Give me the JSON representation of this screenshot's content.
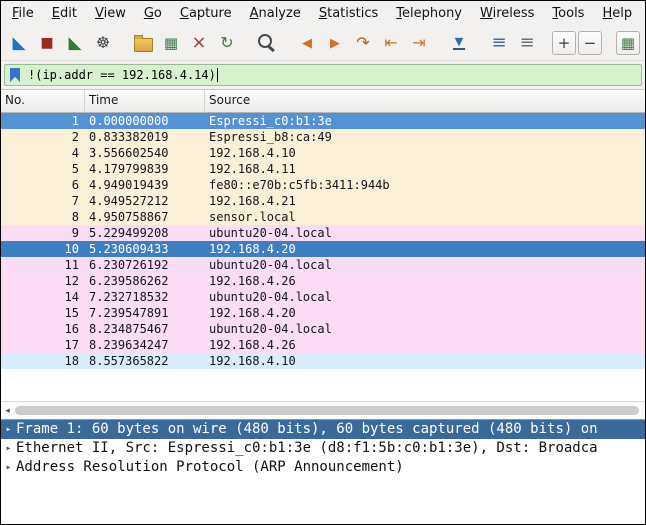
{
  "menu": {
    "items": [
      "File",
      "Edit",
      "View",
      "Go",
      "Capture",
      "Analyze",
      "Statistics",
      "Telephony",
      "Wireless",
      "Tools",
      "Help"
    ]
  },
  "toolbar": {
    "icons": [
      {
        "name": "start-capture",
        "glyph": "◣",
        "color": "#2571c4",
        "size": 17
      },
      {
        "name": "stop-capture",
        "glyph": "■",
        "color": "#9a2b20",
        "size": 14
      },
      {
        "name": "restart-capture",
        "glyph": "◣",
        "color": "#2e7d32",
        "size": 17
      },
      {
        "name": "capture-options",
        "glyph": "☸",
        "color": "#454545",
        "size": 16
      },
      {
        "gap": true
      },
      {
        "name": "open-capture-file",
        "shape": "folder"
      },
      {
        "name": "save-capture-file",
        "glyph": "▦",
        "color": "#3f7d46",
        "size": 15
      },
      {
        "name": "close-capture-file",
        "glyph": "×",
        "color": "#a83a2e",
        "size": 18
      },
      {
        "name": "reload-capture-file",
        "glyph": "↻",
        "color": "#3f7d46",
        "size": 16
      },
      {
        "gap": true
      },
      {
        "name": "find-packet",
        "shape": "magnifier"
      },
      {
        "gap": true
      },
      {
        "name": "go-back",
        "glyph": "◀",
        "color": "#d4712b",
        "size": 13
      },
      {
        "name": "go-forward",
        "glyph": "▶",
        "color": "#d4712b",
        "size": 13
      },
      {
        "name": "go-to-packet",
        "glyph": "↷",
        "color": "#c85a1b",
        "size": 16
      },
      {
        "name": "go-first-packet",
        "glyph": "⇤",
        "color": "#d4712b",
        "size": 16
      },
      {
        "name": "go-last-packet",
        "glyph": "⇥",
        "color": "#d4712b",
        "size": 16
      },
      {
        "gap": true
      },
      {
        "name": "auto-scroll",
        "glyph": "▼",
        "color": "#2a6db0",
        "size": 11,
        "cls": "g-underbar"
      },
      {
        "gap": true
      },
      {
        "name": "colorize-packets",
        "glyph": "≡",
        "color": "#3a6ea5",
        "size": 18
      },
      {
        "name": "coloring-rules",
        "glyph": "≡",
        "color": "#6d6d6d",
        "size": 18
      },
      {
        "spacer": true
      },
      {
        "name": "zoom-in",
        "glyph": "+",
        "color": "#3d3d3d",
        "size": 15,
        "boxed": true
      },
      {
        "name": "zoom-out",
        "glyph": "−",
        "color": "#3d3d3d",
        "size": 15,
        "boxed": true
      },
      {
        "gap": true
      },
      {
        "name": "resize-columns",
        "glyph": "▦",
        "color": "#3f7d46",
        "size": 15,
        "boxed": true
      }
    ]
  },
  "filter": {
    "value": "!(ip.addr == 192.168.4.14)"
  },
  "packet_list": {
    "columns": [
      "No.",
      "Time",
      "Source"
    ],
    "rows": [
      {
        "no": "1",
        "time": "0.000000000",
        "source": "Espressi_c0:b1:3e",
        "style": "selected"
      },
      {
        "no": "2",
        "time": "0.833382019",
        "source": "Espressi_b8:ca:49",
        "style": "cream"
      },
      {
        "no": "4",
        "time": "3.556602540",
        "source": "192.168.4.10",
        "style": "cream"
      },
      {
        "no": "5",
        "time": "4.179799839",
        "source": "192.168.4.11",
        "style": "cream"
      },
      {
        "no": "6",
        "time": "4.949019439",
        "source": "fe80::e70b:c5fb:3411:944b",
        "style": "cream"
      },
      {
        "no": "7",
        "time": "4.949527212",
        "source": "192.168.4.21",
        "style": "cream"
      },
      {
        "no": "8",
        "time": "4.950758867",
        "source": "sensor.local",
        "style": "cream"
      },
      {
        "no": "9",
        "time": "5.229499208",
        "source": "ubuntu20-04.local",
        "style": "pink"
      },
      {
        "no": "10",
        "time": "5.230609433",
        "source": "192.168.4.20",
        "style": "selected-alt"
      },
      {
        "no": "11",
        "time": "6.230726192",
        "source": "ubuntu20-04.local",
        "style": "pink"
      },
      {
        "no": "12",
        "time": "6.239586262",
        "source": "192.168.4.26",
        "style": "pink"
      },
      {
        "no": "14",
        "time": "7.232718532",
        "source": "ubuntu20-04.local",
        "style": "pink"
      },
      {
        "no": "15",
        "time": "7.239547891",
        "source": "192.168.4.20",
        "style": "pink"
      },
      {
        "no": "16",
        "time": "8.234875467",
        "source": "ubuntu20-04.local",
        "style": "pink"
      },
      {
        "no": "17",
        "time": "8.239634247",
        "source": "192.168.4.26",
        "style": "pink"
      },
      {
        "no": "18",
        "time": "8.557365822",
        "source": "192.168.4.10",
        "style": "blue"
      }
    ]
  },
  "scrollbar": {
    "left_stepper": "◂"
  },
  "details": {
    "expander": "▸",
    "lines": [
      {
        "text": "Frame 1: 60 bytes on wire (480 bits), 60 bytes captured (480 bits) on",
        "selected": true
      },
      {
        "text": "Ethernet II, Src: Espressi_c0:b1:3e (d8:f1:5b:c0:b1:3e), Dst: Broadca",
        "selected": false
      },
      {
        "text": "Address Resolution Protocol (ARP Announcement)",
        "selected": false
      }
    ]
  }
}
